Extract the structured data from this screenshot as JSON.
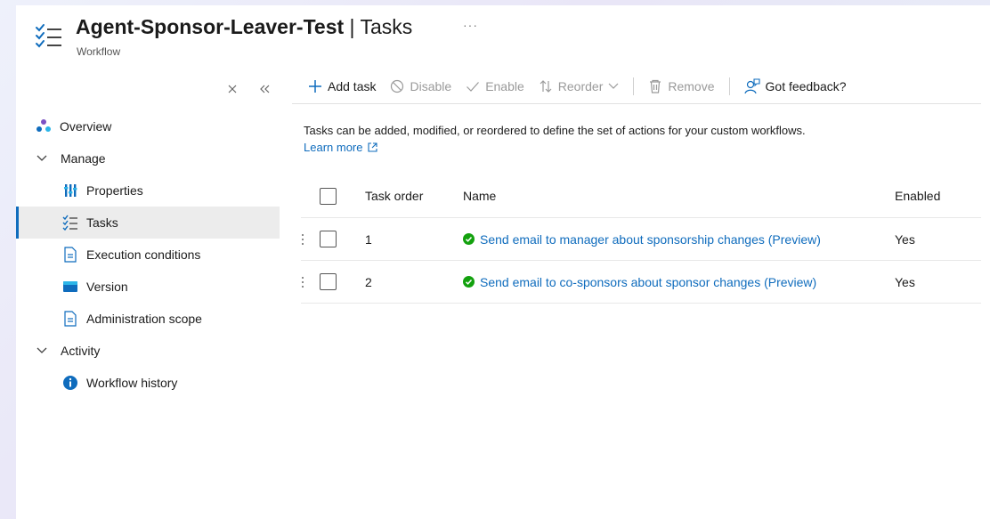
{
  "header": {
    "title_bold": "Agent-Sponsor-Leaver-Test",
    "title_sep": " | ",
    "title_rest": "Tasks",
    "subtitle": "Workflow",
    "more": "···"
  },
  "sidebar": {
    "close_glyph": "✕",
    "collapse_glyph": "«",
    "items": [
      {
        "label": "Overview"
      },
      {
        "label": "Manage"
      },
      {
        "label": "Properties"
      },
      {
        "label": "Tasks"
      },
      {
        "label": "Execution conditions"
      },
      {
        "label": "Version"
      },
      {
        "label": "Administration scope"
      },
      {
        "label": "Activity"
      },
      {
        "label": "Workflow history"
      }
    ]
  },
  "toolbar": {
    "add_task": "Add task",
    "disable": "Disable",
    "enable": "Enable",
    "reorder": "Reorder",
    "remove": "Remove",
    "feedback": "Got feedback?"
  },
  "content": {
    "description": "Tasks can be added, modified, or reordered to define the set of actions for your custom workflows.",
    "learn_more": "Learn more"
  },
  "table": {
    "columns": [
      "Task order",
      "Name",
      "Enabled"
    ],
    "rows": [
      {
        "order": "1",
        "name": "Send email to manager about sponsorship changes (Preview)",
        "enabled": "Yes"
      },
      {
        "order": "2",
        "name": "Send email to co-sponsors about sponsor changes (Preview)",
        "enabled": "Yes"
      }
    ]
  },
  "colors": {
    "accent": "#0f6cbd",
    "success": "#13a10e",
    "text": "#1b1b1b",
    "disabled": "#9a9a9a"
  }
}
